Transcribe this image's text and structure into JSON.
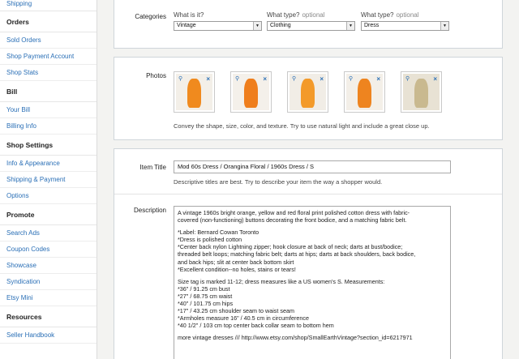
{
  "sidebar": {
    "top_link": "Shipping",
    "sections": [
      {
        "header": "Orders",
        "items": [
          "Sold Orders",
          "Shop Payment Account",
          "Shop Stats"
        ]
      },
      {
        "header": "Bill",
        "items": [
          "Your Bill",
          "Billing Info"
        ]
      },
      {
        "header": "Shop Settings",
        "items": [
          "Info & Appearance",
          "Shipping & Payment",
          "Options"
        ]
      },
      {
        "header": "Promote",
        "items": [
          "Search Ads",
          "Coupon Codes",
          "Showcase",
          "Syndication",
          "Etsy Mini"
        ]
      },
      {
        "header": "Resources",
        "items": [
          "Seller Handbook"
        ]
      }
    ]
  },
  "categories": {
    "label": "Categories",
    "columns": [
      {
        "title": "What is it?",
        "optional": "",
        "value": "Vintage"
      },
      {
        "title": "What type?",
        "optional": "optional",
        "value": "Clothing"
      },
      {
        "title": "What type?",
        "optional": "optional",
        "value": "Dress"
      }
    ]
  },
  "photos": {
    "label": "Photos",
    "hint": "Convey the shape, size, color, and texture. Try to use natural light and include a great close up.",
    "thumbs": [
      {
        "name": "photo-1",
        "bg": "#f3efe8",
        "dress": "#f08a1e"
      },
      {
        "name": "photo-2",
        "bg": "#f4f0ea",
        "dress": "#ef7e1c"
      },
      {
        "name": "photo-3",
        "bg": "#f1ede6",
        "dress": "#f39a2a"
      },
      {
        "name": "photo-4",
        "bg": "#f3efe8",
        "dress": "#ee841f"
      },
      {
        "name": "photo-5",
        "bg": "#e8e2d4",
        "dress": "#c9b98f"
      }
    ]
  },
  "item_title": {
    "label": "Item Title",
    "value": "Mod 60s Dress / Orangina Floral / 1960s Dress / S",
    "hint": "Descriptive titles are best. Try to describe your item the way a shopper would."
  },
  "description": {
    "label": "Description",
    "lines": [
      "A vintage 1960s bright orange, yellow and red floral print polished cotton dress with fabric-",
      "covered (non-functioning) buttons decorating the front bodice, and a matching fabric belt.",
      "",
      "*Label: Bernard Cowan Toronto",
      "*Dress is polished cotton",
      "*Center back nylon Lightning zipper; hook closure at back of neck; darts at bust/bodice;",
      "threaded belt loops; matching fabric belt; darts at hips; darts at back shoulders, back bodice,",
      "and back hips; slit at center back bottom skirt",
      "*Excellent condition--no holes, stains or tears!",
      "",
      "Size tag is marked 11-12; dress measures like a US women's S.  Measurements:",
      "*36\" / 91.25 cm bust",
      "*27\" / 68.75 cm waist",
      "*40\" / 101.75 cm hips",
      "*17\" / 43.25 cm shoulder seam to waist seam",
      "*Armholes measure 16\" / 40.5 cm in circumference",
      "*40 1/2\" / 103 cm top center back collar seam to bottom hem",
      "",
      "more vintage dresses /// http://www.etsy.com/shop/SmallEarthVintage?section_id=6217971"
    ]
  }
}
